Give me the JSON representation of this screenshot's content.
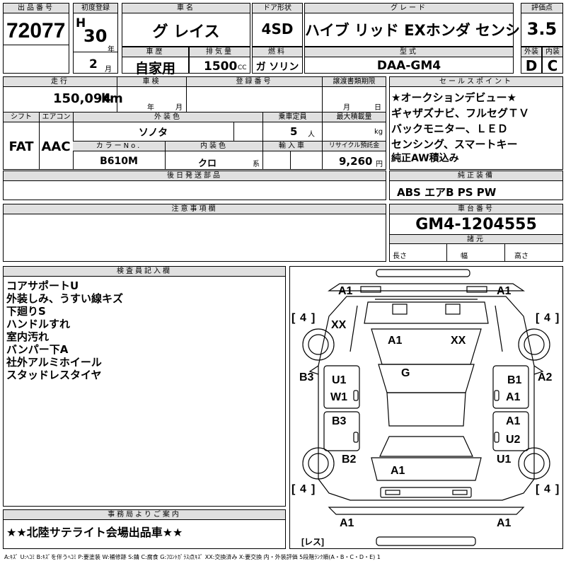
{
  "listing": {
    "lot_number_label": "出品番号",
    "lot_number": "72077",
    "first_reg_label": "初度登録",
    "era": "H",
    "year": "30",
    "year_unit": "年",
    "month": "2",
    "month_unit": "月",
    "car_name_label": "車名",
    "car_name": "グ レイス",
    "door_label": "ドア形状",
    "door": "4SD",
    "grade_label": "グレード",
    "grade": "ハイブ リッド EXホンダ センシング",
    "score_label": "評価点",
    "score": "3.5",
    "history_label": "車歴",
    "history": "自家用",
    "displacement_label": "排気量",
    "displacement": "1500",
    "displacement_unit": "CC",
    "fuel_label": "燃料",
    "fuel": "ガ ソリン",
    "model_label": "型式",
    "model": "DAA-GM4",
    "exterior_label": "外装",
    "exterior": "D",
    "interior_label": "内装",
    "interior": "C"
  },
  "specs": {
    "mileage_label": "走行",
    "mileage": "150,094",
    "mileage_unit": "km",
    "inspection_label": "車検",
    "inspection_year_unit": "年",
    "inspection_month_unit": "月",
    "registration_label": "登録番号",
    "transfer_label": "譲渡書類期限",
    "transfer_month_unit": "月",
    "transfer_day_unit": "日",
    "shift_label": "シフト",
    "shift": "FAT",
    "ac_label": "エアコン",
    "ac": "AAC",
    "ext_color_label": "外装色",
    "ext_color": "ソノタ",
    "capacity_label": "乗車定員",
    "capacity": "5",
    "capacity_unit": "人",
    "load_label": "最大積載量",
    "load_unit": "kg",
    "color_no_label": "カラーNo.",
    "color_no": "B610M",
    "int_color_label": "内装色",
    "int_color": "クロ",
    "int_color_unit": "系",
    "import_label": "輸入車",
    "recycle_label": "リサイクル預託金",
    "recycle": "9,260",
    "recycle_unit": "円"
  },
  "later_parts_label": "後日発送部品",
  "notes_label": "注意事項欄",
  "sales_points": {
    "label": "セールスポイント",
    "items": [
      "★オークションデビュー★",
      "ギャザズナビ、フルセグＴＶ",
      "バックモニター、ＬＥＤ",
      "センシング、スマートキー",
      "純正AW積込み"
    ]
  },
  "equipment": {
    "label": "純正装備",
    "value": "ABS エアB PS PW"
  },
  "chassis": {
    "label": "車台番号",
    "value": "GM4-1204555"
  },
  "dims": {
    "label": "諸元",
    "length": "長さ",
    "width": "幅",
    "height": "高さ"
  },
  "inspector": {
    "label": "検査員記入欄",
    "items": [
      "コアサポートU",
      "外装しみ、うすい線キズ",
      "下廻りS",
      "ハンドルすれ",
      "室内汚れ",
      "バンパー下A",
      "社外アルミホイール",
      "スタッドレスタイヤ"
    ]
  },
  "diagram": {
    "front_left": "A1",
    "front_right": "A1",
    "tread_fl": "4",
    "tread_fr": "4",
    "tread_rl": "4",
    "tread_rr": "4",
    "hood_left": "XX",
    "windshield_left": "A1",
    "windshield_right": "XX",
    "roof": "G",
    "left_b3": "B3",
    "right_a2": "A2",
    "door_u1": "U1",
    "door_w1": "W1",
    "door_b1": "B1",
    "door_a1a": "A1",
    "door_b3": "B3",
    "door_a1b": "A1",
    "door_u2": "U2",
    "rear_b2": "B2",
    "rear_u1": "U1",
    "trunk": "A1",
    "rear_left": "A1",
    "rear_right": "A1",
    "bracket_l": "[",
    "bracket_r": "]",
    "spare": "[レス]"
  },
  "office": {
    "label": "事務局よりご案内",
    "text": "★★北陸サテライト会場出品車★★"
  },
  "legend": "A:ｷｽﾞ U:ﾍｺﾐ B:ｷｽﾞを伴うﾍｺﾐ P:要塗装 W:補修跡 S:錆 C:腐食 G:ﾌﾛﾝﾄｶﾞﾗｽ点ｷｽﾞ XX:交換済み X:要交換 内・外装評価 5段階ﾗﾝｸ順(A・B・C・D・E) 1"
}
